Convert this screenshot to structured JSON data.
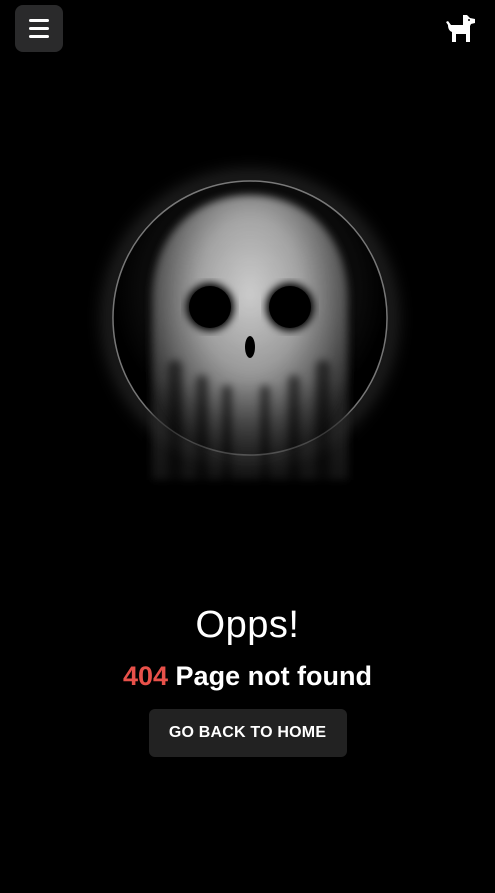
{
  "header": {
    "menu_icon": "hamburger-menu-icon",
    "logo_icon": "dog-logo-icon"
  },
  "main": {
    "title": "Opps!",
    "error_code": "404",
    "error_message": "Page not found",
    "home_button_label": "GO BACK TO HOME",
    "illustration": "ghost-skull-icon"
  },
  "colors": {
    "background": "#000000",
    "accent_red": "#e8514a",
    "button_bg": "#222222",
    "menu_bg": "#2a2a2b"
  }
}
